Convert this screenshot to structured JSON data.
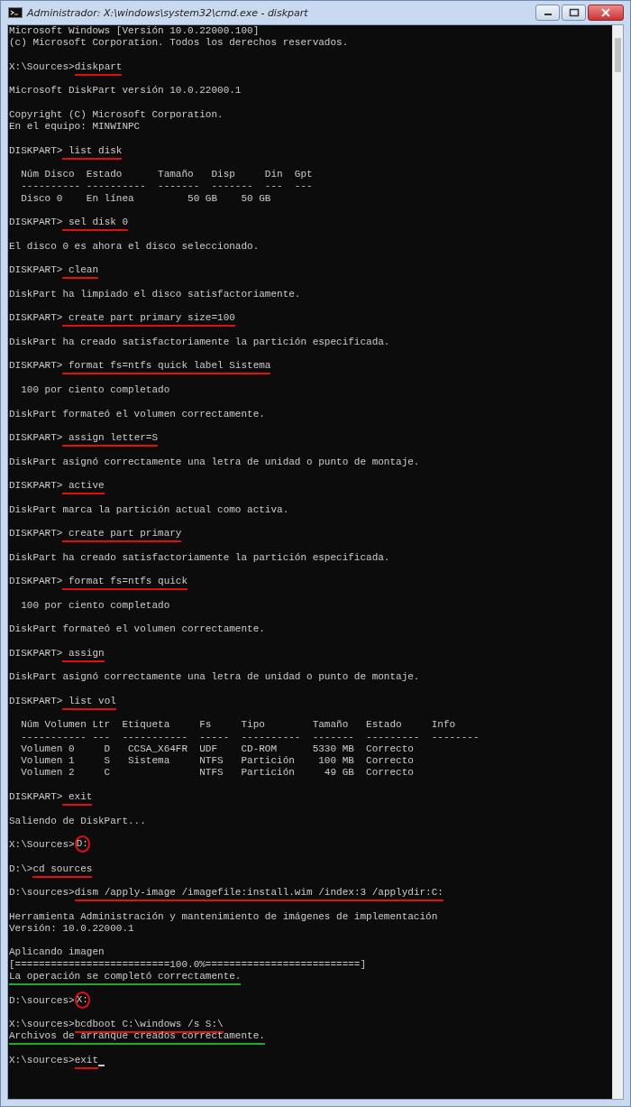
{
  "window": {
    "title": "Administrador: X:\\windows\\system32\\cmd.exe - diskpart"
  },
  "lines": [
    {
      "kind": "text",
      "text": "Microsoft Windows [Versión 10.0.22000.100]"
    },
    {
      "kind": "text",
      "text": "(c) Microsoft Corporation. Todos los derechos reservados."
    },
    {
      "kind": "blank"
    },
    {
      "kind": "command",
      "prompt": "X:\\Sources>",
      "command": "diskpart",
      "underlined": true,
      "color": "#e01010"
    },
    {
      "kind": "blank"
    },
    {
      "kind": "text",
      "text": "Microsoft DiskPart versión 10.0.22000.1"
    },
    {
      "kind": "blank"
    },
    {
      "kind": "text",
      "text": "Copyright (C) Microsoft Corporation."
    },
    {
      "kind": "text",
      "text": "En el equipo: MINWINPC"
    },
    {
      "kind": "blank"
    },
    {
      "kind": "command",
      "prompt": "DISKPART>",
      "command": " list disk",
      "underlined": true,
      "color": "#e01010"
    },
    {
      "kind": "blank"
    },
    {
      "kind": "text",
      "text": "  Núm Disco  Estado      Tamaño   Disp     Din  Gpt"
    },
    {
      "kind": "text",
      "text": "  ---------- ----------  -------  -------  ---  ---"
    },
    {
      "kind": "text",
      "text": "  Disco 0    En línea         50 GB    50 GB"
    },
    {
      "kind": "blank"
    },
    {
      "kind": "command",
      "prompt": "DISKPART>",
      "command": " sel disk 0",
      "underlined": true,
      "color": "#e01010"
    },
    {
      "kind": "blank"
    },
    {
      "kind": "text",
      "text": "El disco 0 es ahora el disco seleccionado."
    },
    {
      "kind": "blank"
    },
    {
      "kind": "command",
      "prompt": "DISKPART>",
      "command": " clean",
      "underlined": true,
      "color": "#e01010"
    },
    {
      "kind": "blank"
    },
    {
      "kind": "text",
      "text": "DiskPart ha limpiado el disco satisfactoriamente."
    },
    {
      "kind": "blank"
    },
    {
      "kind": "command",
      "prompt": "DISKPART>",
      "command": " create part primary size=100",
      "underlined": true,
      "color": "#e01010"
    },
    {
      "kind": "blank"
    },
    {
      "kind": "text",
      "text": "DiskPart ha creado satisfactoriamente la partición especificada."
    },
    {
      "kind": "blank"
    },
    {
      "kind": "command",
      "prompt": "DISKPART>",
      "command": " format fs=ntfs quick label Sistema",
      "underlined": true,
      "color": "#e01010"
    },
    {
      "kind": "blank"
    },
    {
      "kind": "text",
      "text": "  100 por ciento completado"
    },
    {
      "kind": "blank"
    },
    {
      "kind": "text",
      "text": "DiskPart formateó el volumen correctamente."
    },
    {
      "kind": "blank"
    },
    {
      "kind": "command",
      "prompt": "DISKPART>",
      "command": " assign letter=S",
      "underlined": true,
      "color": "#e01010"
    },
    {
      "kind": "blank"
    },
    {
      "kind": "text",
      "text": "DiskPart asignó correctamente una letra de unidad o punto de montaje."
    },
    {
      "kind": "blank"
    },
    {
      "kind": "command",
      "prompt": "DISKPART>",
      "command": " active",
      "underlined": true,
      "color": "#e01010"
    },
    {
      "kind": "blank"
    },
    {
      "kind": "text",
      "text": "DiskPart marca la partición actual como activa."
    },
    {
      "kind": "blank"
    },
    {
      "kind": "command",
      "prompt": "DISKPART>",
      "command": " create part primary",
      "underlined": true,
      "color": "#e01010"
    },
    {
      "kind": "blank"
    },
    {
      "kind": "text",
      "text": "DiskPart ha creado satisfactoriamente la partición especificada."
    },
    {
      "kind": "blank"
    },
    {
      "kind": "command",
      "prompt": "DISKPART>",
      "command": " format fs=ntfs quick",
      "underlined": true,
      "color": "#e01010"
    },
    {
      "kind": "blank"
    },
    {
      "kind": "text",
      "text": "  100 por ciento completado"
    },
    {
      "kind": "blank"
    },
    {
      "kind": "text",
      "text": "DiskPart formateó el volumen correctamente."
    },
    {
      "kind": "blank"
    },
    {
      "kind": "command",
      "prompt": "DISKPART>",
      "command": " assign",
      "underlined": true,
      "color": "#e01010"
    },
    {
      "kind": "blank"
    },
    {
      "kind": "text",
      "text": "DiskPart asignó correctamente una letra de unidad o punto de montaje."
    },
    {
      "kind": "blank"
    },
    {
      "kind": "command",
      "prompt": "DISKPART>",
      "command": " list vol",
      "underlined": true,
      "color": "#e01010"
    },
    {
      "kind": "blank"
    },
    {
      "kind": "text",
      "text": "  Núm Volumen Ltr  Etiqueta     Fs     Tipo        Tamaño   Estado     Info"
    },
    {
      "kind": "text",
      "text": "  ----------- ---  -----------  -----  ----------  -------  ---------  --------"
    },
    {
      "kind": "text",
      "text": "  Volumen 0     D   CCSA_X64FR  UDF    CD-ROM      5330 MB  Correcto"
    },
    {
      "kind": "text",
      "text": "  Volumen 1     S   Sistema     NTFS   Partición    100 MB  Correcto"
    },
    {
      "kind": "text",
      "text": "  Volumen 2     C               NTFS   Partición     49 GB  Correcto"
    },
    {
      "kind": "blank"
    },
    {
      "kind": "command",
      "prompt": "DISKPART>",
      "command": " exit",
      "underlined": true,
      "color": "#e01010"
    },
    {
      "kind": "blank"
    },
    {
      "kind": "text",
      "text": "Saliendo de DiskPart..."
    },
    {
      "kind": "blank"
    },
    {
      "kind": "command",
      "prompt": "X:\\Sources>",
      "command": "D:",
      "circled": true,
      "color": "#e01010"
    },
    {
      "kind": "blank"
    },
    {
      "kind": "command",
      "prompt": "D:\\>",
      "command": "cd sources",
      "underlined": true,
      "color": "#e01010"
    },
    {
      "kind": "blank"
    },
    {
      "kind": "command",
      "prompt": "D:\\sources>",
      "command": "dism /apply-image /imagefile:install.wim /index:3 /applydir:C:",
      "underlined": true,
      "color": "#e01010"
    },
    {
      "kind": "blank"
    },
    {
      "kind": "text",
      "text": "Herramienta Administración y mantenimiento de imágenes de implementación"
    },
    {
      "kind": "text",
      "text": "Versión: 10.0.22000.1"
    },
    {
      "kind": "blank"
    },
    {
      "kind": "text",
      "text": "Aplicando imagen"
    },
    {
      "kind": "text",
      "text": "[==========================100.0%==========================]"
    },
    {
      "kind": "text",
      "text": "La operación se completó correctamente.",
      "underlined": true,
      "color": "#22a830"
    },
    {
      "kind": "blank"
    },
    {
      "kind": "command",
      "prompt": "D:\\sources>",
      "command": "X:",
      "circled": true,
      "color": "#e01010"
    },
    {
      "kind": "blank"
    },
    {
      "kind": "command",
      "prompt": "X:\\sources>",
      "command": "bcdboot C:\\windows /s S:\\",
      "underlined": true,
      "color": "#e01010"
    },
    {
      "kind": "text",
      "text": "Archivos de arranque creados correctamente.",
      "underlined": true,
      "color": "#22a830"
    },
    {
      "kind": "blank"
    },
    {
      "kind": "command",
      "prompt": "X:\\sources>",
      "command": "exit",
      "underlined": true,
      "color": "#e01010",
      "cursor": true
    }
  ]
}
